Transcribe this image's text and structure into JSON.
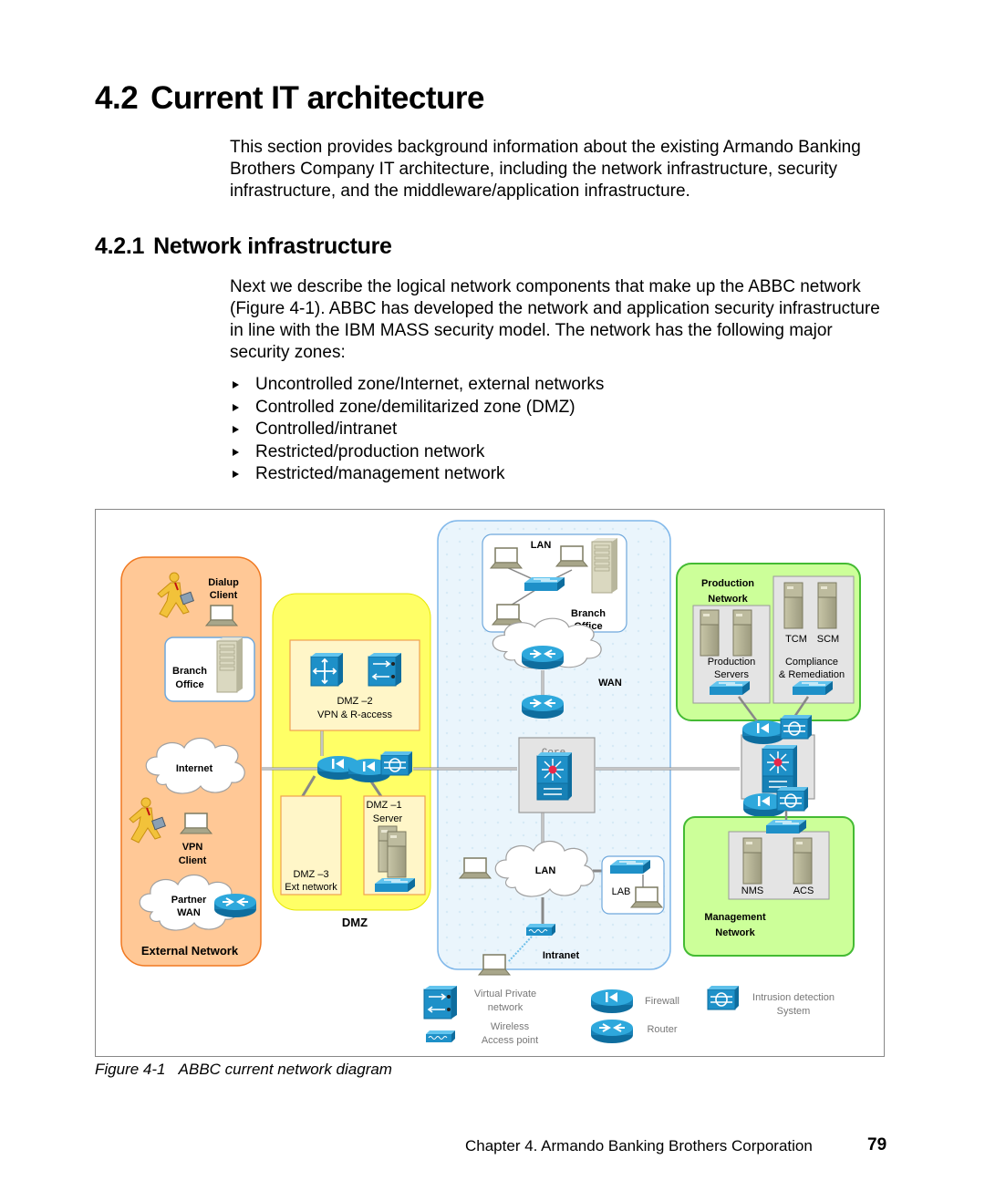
{
  "section": {
    "number": "4.2",
    "title": "Current IT architecture",
    "intro": "This section provides background information about the existing Armando Banking Brothers Company IT architecture, including the network infrastructure, security infrastructure, and the middleware/application infrastructure."
  },
  "subsection": {
    "number": "4.2.1",
    "title": "Network infrastructure",
    "intro": "Next we describe the logical network components that make up the ABBC network (Figure 4-1). ABBC has developed the network and application security infrastructure in line with the IBM MASS security model. The network has the following major security zones:",
    "bullets": [
      "Uncontrolled zone/Internet, external networks",
      "Controlled zone/demilitarized zone (DMZ)",
      "Controlled/intranet",
      "Restricted/production network",
      "Restricted/management network"
    ]
  },
  "diagram": {
    "colors": {
      "external": "#FFC896",
      "external_border": "#F07820",
      "dmz": "#FFFF66",
      "intranet": "#E8F4FC",
      "intranet_border": "#7FB7EA",
      "green": "#CCFF99",
      "green_border": "#44BB33",
      "cisco_blue": "#1E90C8"
    },
    "external": {
      "zone_label": "External Network",
      "dialup_label_1": "Dialup",
      "dialup_label_2": "Client",
      "branch_label_1": "Branch",
      "branch_label_2": "Office",
      "internet_label": "Internet",
      "vpn_label_1": "VPN",
      "vpn_label_2": "Client",
      "partner_label_1": "Partner",
      "partner_label_2": "WAN"
    },
    "dmz": {
      "zone_label": "DMZ",
      "dmz2_label_1": "DMZ –2",
      "dmz2_label_2": "VPN & R-access",
      "dmz1_label_1": "DMZ –1",
      "dmz1_label_2": "Server",
      "dmz3_label_1": "DMZ –3",
      "dmz3_label_2": "Ext network"
    },
    "intranet": {
      "zone_label": "Intranet",
      "lan_top_label": "LAN",
      "branch_label_1": "Branch",
      "branch_label_2": "Office",
      "wan_label": "WAN",
      "core_label": "Core",
      "lan_label": "LAN",
      "lab_label": "LAB"
    },
    "production": {
      "zone_label_1": "Production",
      "zone_label_2": "Network",
      "tcm_label": "TCM",
      "scm_label": "SCM",
      "servers_label_1": "Production",
      "servers_label_2": "Servers",
      "compliance_label_1": "Compliance",
      "compliance_label_2": "& Remediation"
    },
    "management": {
      "zone_label_1": "Management",
      "zone_label_2": "Network",
      "nms_label": "NMS",
      "acs_label": "ACS"
    },
    "legend": {
      "vpn_label_1": "Virtual Private",
      "vpn_label_2": "network",
      "wireless_label_1": "Wireless",
      "wireless_label_2": "Access point",
      "firewall_label": "Firewall",
      "router_label": "Router",
      "ids_label_1": "Intrusion detection",
      "ids_label_2": "System"
    }
  },
  "figure": {
    "number": "Figure 4-1",
    "caption": "ABBC current network diagram"
  },
  "footer": {
    "chapter": "Chapter 4. Armando Banking Brothers Corporation",
    "page": "79"
  }
}
